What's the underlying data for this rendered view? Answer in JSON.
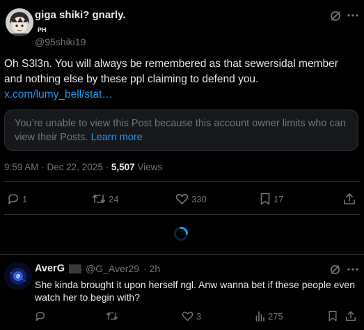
{
  "post": {
    "author_name": "giga shiki? gnarly.",
    "author_badge": "PH",
    "author_handle": "@95shiki19",
    "text_line1": "Oh S3l3n. You will always be remembered as that sewersidal member",
    "text_line2": "and nothing else by these ppl claiming to defend you.",
    "link_text": "x.com/lumy_bell/stat…",
    "quote_notice": "You’re unable to view this Post because this account owner limits who can",
    "quote_notice_line2": "view their Posts.",
    "learn_more": "Learn more",
    "timestamp": "9:59 AM · Dec 22, 2025 · ",
    "views_count": "5,507",
    "views_label": " Views",
    "stats": {
      "replies": "1",
      "reposts": "24",
      "likes": "330",
      "bookmarks": "17"
    }
  },
  "reply": {
    "author_name": "AverG",
    "author_handle": "@G_Aver29",
    "time": "· 2h",
    "text_line1": "She kinda brought it upon herself ngl. Anw wanna bet if these people even",
    "text_line2": "watch her to begin with?",
    "stats": {
      "likes": "3",
      "views": "275"
    }
  },
  "colors": {
    "background": "#000000",
    "text": "#e7e9ea",
    "muted": "#71767b",
    "accent": "#1d9bf0",
    "border": "#2f3336"
  }
}
